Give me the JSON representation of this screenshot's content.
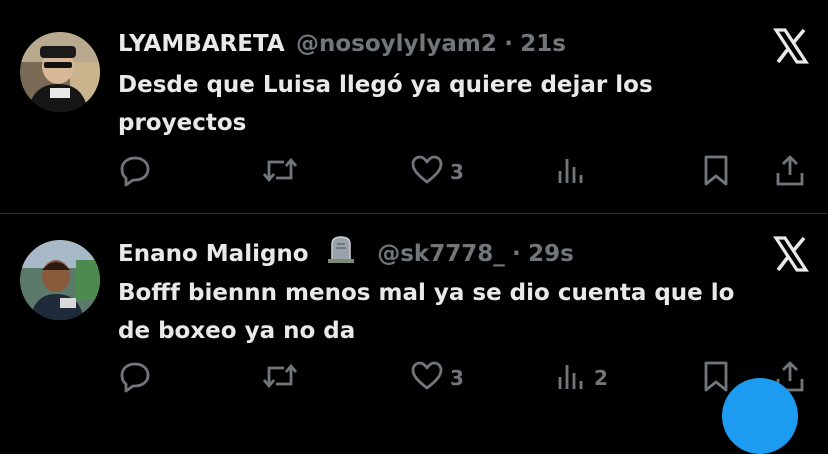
{
  "tweets": [
    {
      "name": "LYAMBARETA",
      "handle": "@nosoylylyam2",
      "separator": "·",
      "time": "21s",
      "text": "Desde que Luisa llegó ya quiere dejar los proyectos",
      "likes": "3",
      "views": "",
      "has_badge": false
    },
    {
      "name": "Enano Maligno",
      "handle": "@sk7778_",
      "separator": "·",
      "time": "29s",
      "text": "Bofff biennn menos mal ya se dio cuenta que lo de boxeo ya no da",
      "likes": "3",
      "views": "2",
      "has_badge": true,
      "badge_icon": "tombstone-emoji"
    }
  ],
  "icons": {
    "close": "x-logo-icon",
    "reply": "reply-icon",
    "retweet": "retweet-icon",
    "like": "heart-icon",
    "views": "views-icon",
    "bookmark": "bookmark-icon",
    "share": "share-icon"
  },
  "colors": {
    "background": "#000000",
    "primary_text": "#e7e9ea",
    "secondary_text": "#71767b",
    "divider": "#2f3336",
    "accent": "#1d9bf0"
  }
}
